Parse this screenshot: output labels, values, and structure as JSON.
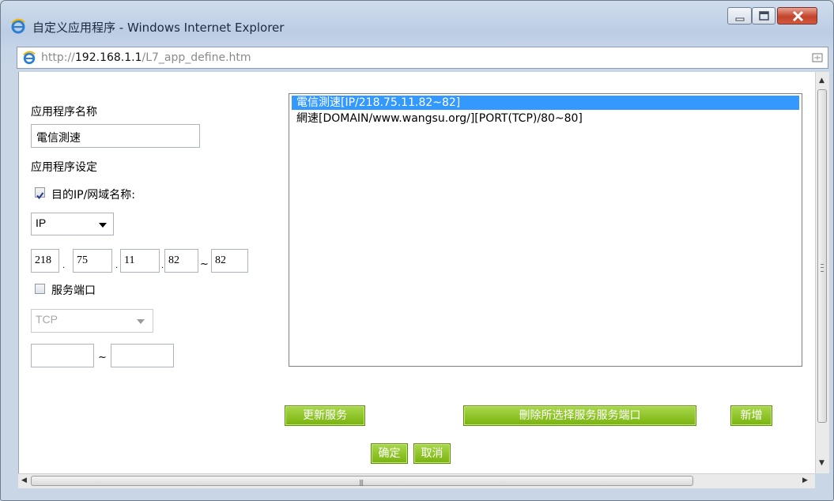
{
  "window": {
    "title": "自定义应用程序 - Windows Internet Explorer",
    "address_prefix": "http://",
    "address_host": "192.168.1.1",
    "address_path": "/L7_app_define.htm"
  },
  "form": {
    "app_name_label": "应用程序名称",
    "app_name_value": "電信測速",
    "app_setting_label": "应用程序设定",
    "dest_checkbox_label": "目的IP/网域名称:",
    "dest_checked": true,
    "dest_type": "IP",
    "ip": [
      "218",
      "75",
      "11",
      "82"
    ],
    "ip_end": "82",
    "ip_range_sep": "~",
    "service_port_label": "服务端口",
    "service_port_checked": false,
    "protocol": "TCP",
    "port_from": "",
    "port_to": "",
    "port_range_sep": "~"
  },
  "rules_list": [
    "電信測速[IP/218.75.11.82~82]",
    "網速[DOMAIN/www.wangsu.org/][PORT(TCP)/80~80]"
  ],
  "buttons": {
    "update": "更新服务",
    "delete": "刪除所选择服务服务端口",
    "add": "新增",
    "ok": "确定",
    "cancel": "取消"
  },
  "colors": {
    "button_green": "#8cc41f",
    "selection_blue": "#3399ff",
    "close_red": "#c7452d"
  }
}
